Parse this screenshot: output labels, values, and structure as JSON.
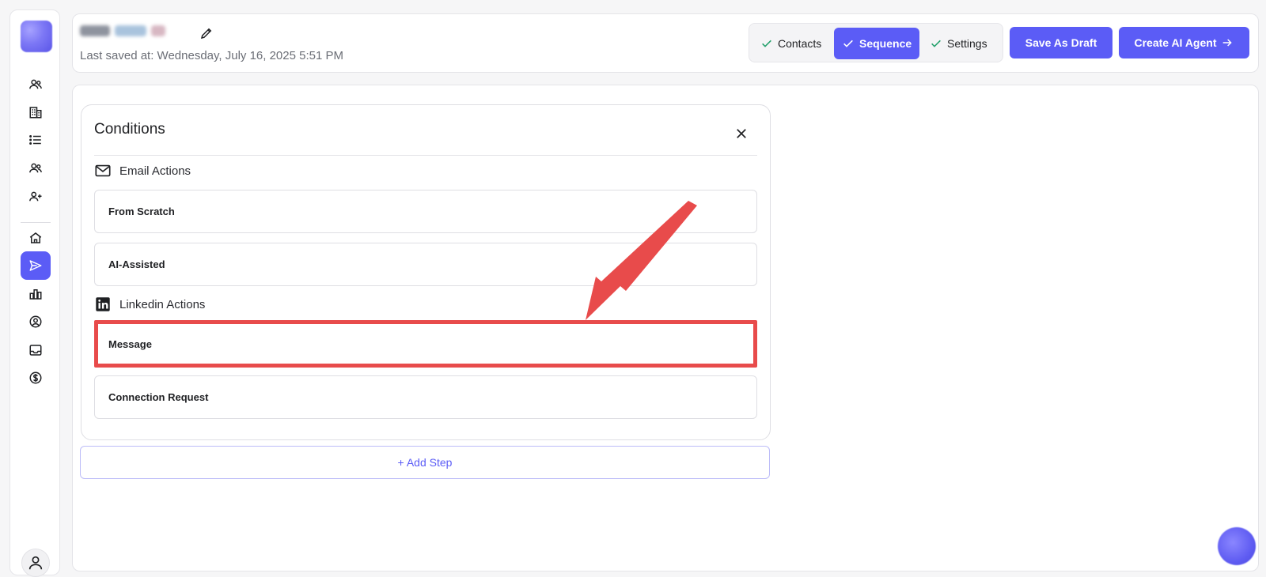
{
  "header": {
    "last_saved": "Last saved at: Wednesday, July 16, 2025 5:51 PM",
    "steps": [
      {
        "label": "Contacts",
        "active": false
      },
      {
        "label": "Sequence",
        "active": true
      },
      {
        "label": "Settings",
        "active": false
      }
    ],
    "save_draft_label": "Save As Draft",
    "create_agent_label": "Create AI Agent"
  },
  "sidebar": {
    "icons": [
      "people-icon",
      "building-icon",
      "list-icon",
      "contacts-icon",
      "add-person-icon",
      "home-icon",
      "send-icon",
      "bar-chart-icon",
      "user-circle-icon",
      "inbox-icon",
      "dollar-icon"
    ],
    "active_icon": "send-icon"
  },
  "conditions": {
    "title": "Conditions",
    "email_section": {
      "label": "Email Actions",
      "items": [
        "From Scratch",
        "AI-Assisted"
      ]
    },
    "linkedin_section": {
      "label": "Linkedin Actions",
      "items": [
        "Message",
        "Connection Request"
      ]
    },
    "highlighted_item": "Message"
  },
  "add_step_label": "+ Add Step",
  "colors": {
    "accent": "#5b5cf6",
    "highlight": "#e84b4b",
    "check": "#22a06b"
  }
}
